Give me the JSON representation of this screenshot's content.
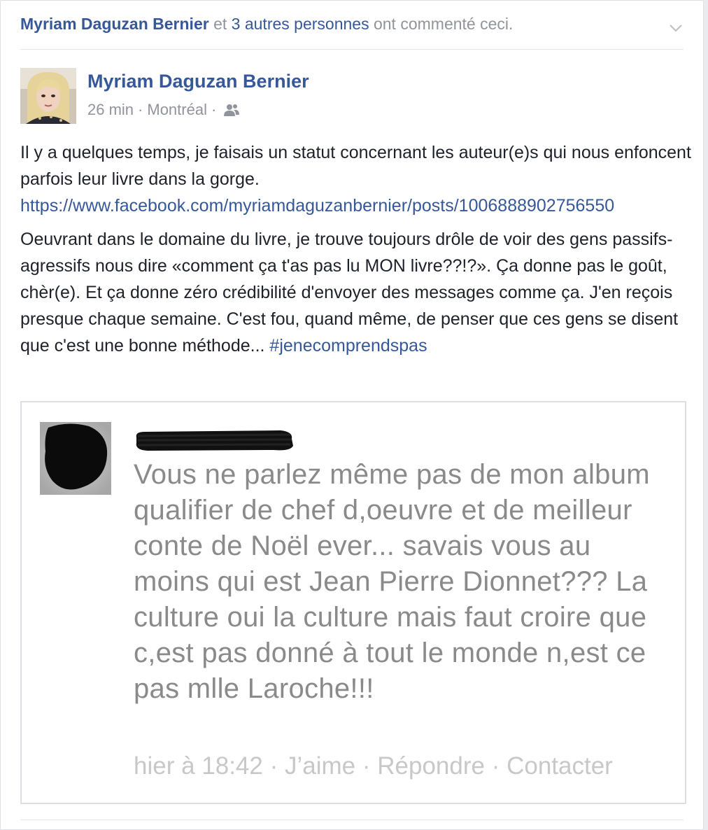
{
  "story_header": {
    "actor": "Myriam Daguzan Bernier",
    "conjunction": " et ",
    "others": "3 autres personnes",
    "action": " ont commenté ceci.",
    "menu_icon": "chevron-down-icon"
  },
  "post": {
    "author": "Myriam Daguzan Bernier",
    "time": "26 min",
    "separator": " · ",
    "location": "Montréal",
    "audience_icon": "friends-icon",
    "paragraph1": "Il y a quelques temps, je faisais un statut concernant les auteur(e)s qui nous enfoncent parfois leur livre dans la gorge.",
    "link": "https://www.facebook.com/myriamdaguzanbernier/posts/1006888902756550",
    "paragraph2": "Oeuvrant dans le domaine du livre, je trouve toujours drôle de voir des gens passifs-agressifs nous dire «comment ça t'as pas lu MON livre??!?». Ça donne pas le goût, chèr(e). Et ça donne zéro crédibilité d'envoyer des messages comme ça. J'en reçois presque chaque semaine. C'est fou, quand même, de penser que ces gens se disent que c'est une bonne méthode... ",
    "hashtag": "#jenecomprendspas"
  },
  "screenshot_comment": {
    "text": "Vous ne parlez même pas de mon album qualifier de chef d,oeuvre et de meilleur conte de Noël ever... savais vous au moins qui est Jean Pierre Dionnet??? La culture oui la culture mais faut croire que c,est pas donné à tout le monde n,est ce pas mlle Laroche!!!",
    "time": "hier à 18:42",
    "sep": " · ",
    "like": "J’aime",
    "reply": "Répondre",
    "contact": "Contacter"
  },
  "colors": {
    "link_blue": "#365899",
    "meta_gray": "#90949c",
    "text": "#1d2129"
  }
}
